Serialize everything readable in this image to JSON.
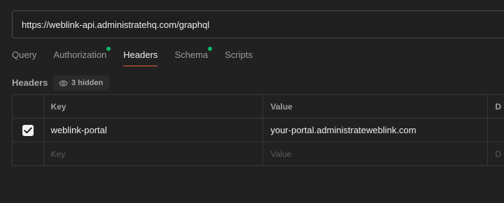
{
  "url_bar": {
    "value": "https://weblink-api.administratehq.com/graphql"
  },
  "tabs": [
    {
      "label": "Query",
      "active": false,
      "has_dot": false
    },
    {
      "label": "Authorization",
      "active": false,
      "has_dot": true
    },
    {
      "label": "Headers",
      "active": true,
      "has_dot": false
    },
    {
      "label": "Schema",
      "active": false,
      "has_dot": true
    },
    {
      "label": "Scripts",
      "active": false,
      "has_dot": false
    }
  ],
  "headers_section": {
    "title": "Headers",
    "hidden_label": "3 hidden"
  },
  "table": {
    "columns": {
      "key": "Key",
      "value": "Value",
      "description": "D"
    },
    "rows": [
      {
        "checked": true,
        "key": "weblink-portal",
        "value": "your-portal.administrateweblink.com",
        "description": ""
      }
    ],
    "placeholder_row": {
      "key": "Key",
      "value": "Value",
      "description": "D"
    }
  },
  "colors": {
    "background": "#212121",
    "active_tab_underline": "#e8613a",
    "status_dot": "#0fb96a"
  }
}
